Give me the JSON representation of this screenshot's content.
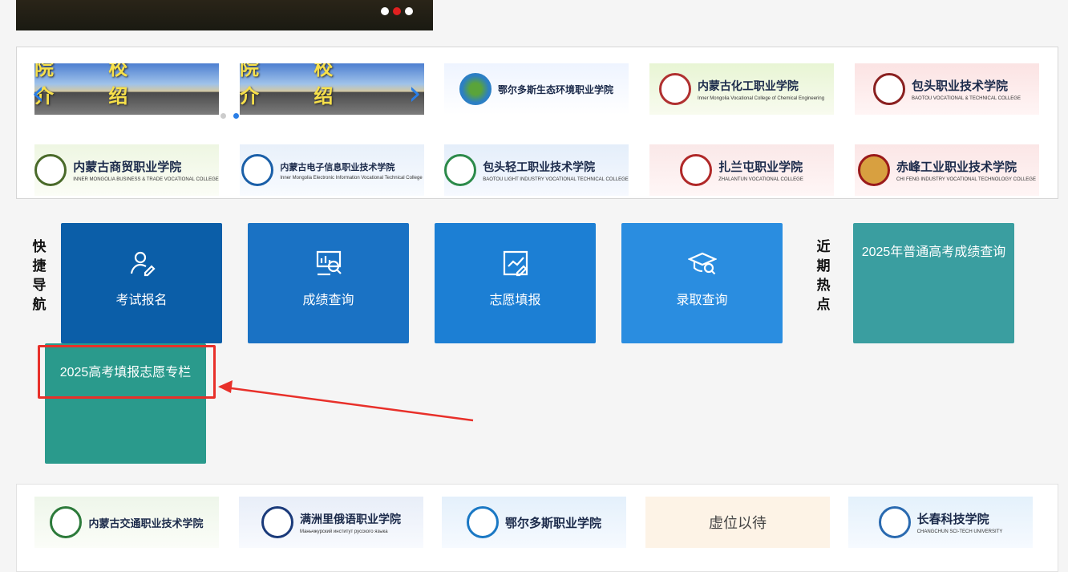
{
  "banner": {
    "slides": 3,
    "active_slide": 2
  },
  "college_logos": {
    "intro_label": "院 校 介 绍",
    "row1": [
      {
        "name": "院校介绍"
      },
      {
        "name": "院校介绍"
      },
      {
        "name": "鄂尔多斯生态环境职业学院"
      },
      {
        "name": "内蒙古化工职业学院",
        "subtitle": "Inner Mongolia Vocational College of Chemical Engineering"
      },
      {
        "name": "包头职业技术学院",
        "subtitle": "BAOTOU VOCATIONAL & TECHNICAL COLLEGE"
      }
    ],
    "row2": [
      {
        "name": "内蒙古商贸职业学院",
        "subtitle": "INNER MONGOLIA BUSINESS & TRADE VOCATIONAL COLLEGE"
      },
      {
        "name": "内蒙古电子信息职业技术学院",
        "subtitle": "Inner Mongolia Electronic Information Vocational Technical College"
      },
      {
        "name": "包头轻工职业技术学院",
        "subtitle": "BAOTOU LIGHT INDUSTRY VOCATIONAL TECHNICAL COLLEGE"
      },
      {
        "name": "扎兰屯职业学院",
        "subtitle": "ZHALANTUN VOCATIONAL COLLEGE"
      },
      {
        "name": "赤峰工业职业技术学院",
        "subtitle": "CHI FENG INDUSTRY VOCATIONAL TECHNOLOGY COLLEGE"
      }
    ],
    "row3": [
      {
        "name": "内蒙古交通职业技术学院"
      },
      {
        "name": "满洲里俄语职业学院",
        "subtitle": "Маньчжурский институт русского языка"
      },
      {
        "name": "鄂尔多斯职业学院"
      },
      {
        "name": "虚位以待"
      },
      {
        "name": "长春科技学院",
        "subtitle": "CHANGCHUN SCI-TECH UNIVERSITY"
      }
    ]
  },
  "quick_nav": {
    "label": "快捷导航",
    "items": [
      {
        "label": "考试报名",
        "icon": "person-edit-icon",
        "color": "#0b5ea8"
      },
      {
        "label": "成绩查询",
        "icon": "chart-search-icon",
        "color": "#1a72c4"
      },
      {
        "label": "志愿填报",
        "icon": "trend-edit-icon",
        "color": "#1c7fd4"
      },
      {
        "label": "录取查询",
        "icon": "graduation-search-icon",
        "color": "#2a8de0"
      }
    ]
  },
  "hot_topics": {
    "label": "近期热点",
    "items": [
      {
        "label": "2025年普通高考成绩查询",
        "color": "#3a9ea0"
      },
      {
        "label": "2025高考填报志愿专栏",
        "color": "#2a9a8c"
      }
    ]
  },
  "annotation": {
    "highlight_color": "#e8302a"
  }
}
